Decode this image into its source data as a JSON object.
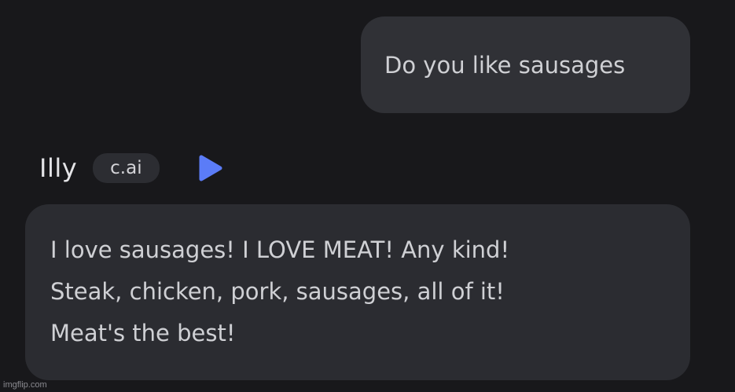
{
  "user_message": {
    "text": "Do you like sausages"
  },
  "character": {
    "name": "Illy",
    "badge": "c.ai",
    "play_icon": "play-icon",
    "accent_color": "#5b7cf7"
  },
  "bot_message": {
    "lines": [
      "I love sausages! I LOVE MEAT! Any kind!",
      "Steak, chicken, pork, sausages, all of it!",
      "Meat's the best!"
    ]
  },
  "watermark": {
    "text": "imgflip.com"
  }
}
